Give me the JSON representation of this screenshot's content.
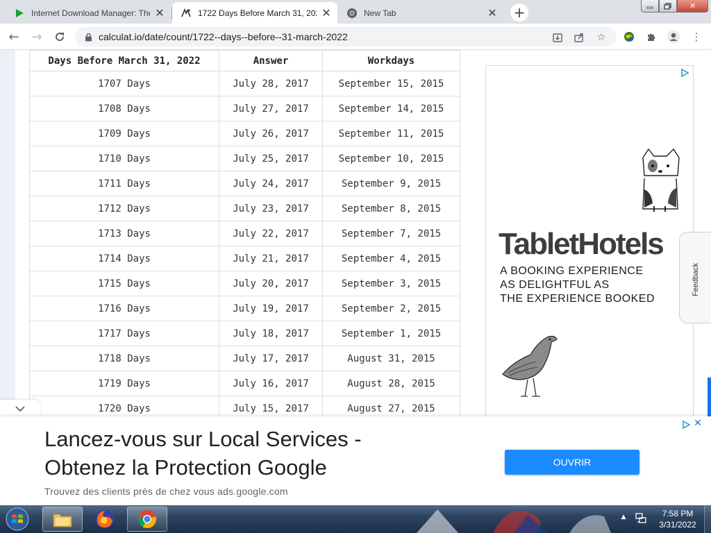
{
  "browser": {
    "tabs": [
      {
        "title": "Internet Download Manager: The",
        "favicon": "idm-play-icon",
        "active": false
      },
      {
        "title": "1722 Days Before March 31, 202",
        "favicon": "calculat-icon",
        "active": true
      },
      {
        "title": "New Tab",
        "favicon": "chrome-icon",
        "active": false
      }
    ],
    "new_tab_symbol": "+",
    "url": "calculat.io/date/count/1722--days--before--31-march-2022"
  },
  "table": {
    "headers": [
      "Days Before March 31, 2022",
      "Answer",
      "Workdays"
    ],
    "rows": [
      [
        "1707 Days",
        "July 28, 2017",
        "September 15, 2015"
      ],
      [
        "1708 Days",
        "July 27, 2017",
        "September 14, 2015"
      ],
      [
        "1709 Days",
        "July 26, 2017",
        "September 11, 2015"
      ],
      [
        "1710 Days",
        "July 25, 2017",
        "September 10, 2015"
      ],
      [
        "1711 Days",
        "July 24, 2017",
        "September 9, 2015"
      ],
      [
        "1712 Days",
        "July 23, 2017",
        "September 8, 2015"
      ],
      [
        "1713 Days",
        "July 22, 2017",
        "September 7, 2015"
      ],
      [
        "1714 Days",
        "July 21, 2017",
        "September 4, 2015"
      ],
      [
        "1715 Days",
        "July 20, 2017",
        "September 3, 2015"
      ],
      [
        "1716 Days",
        "July 19, 2017",
        "September 2, 2015"
      ],
      [
        "1717 Days",
        "July 18, 2017",
        "September 1, 2015"
      ],
      [
        "1718 Days",
        "July 17, 2017",
        "August 31, 2015"
      ],
      [
        "1719 Days",
        "July 16, 2017",
        "August 28, 2015"
      ],
      [
        "1720 Days",
        "July 15, 2017",
        "August 27, 2015"
      ]
    ]
  },
  "side_ad": {
    "brand": "TabletHotels",
    "tagline": [
      "A BOOKING EXPERIENCE",
      "AS DELIGHTFUL AS",
      "THE EXPERIENCE BOOKED"
    ]
  },
  "feedback": {
    "label": "Feedback"
  },
  "anchor_ad": {
    "headline": [
      "Lancez-vous sur Local Services -",
      "Obtenez la Protection Google"
    ],
    "description": "Trouvez des clients près de chez vous ads.google.com",
    "cta": "OUVRIR",
    "close_symbol": "✕"
  },
  "taskbar": {
    "clock_time": "7:58 PM",
    "clock_date": "3/31/2022",
    "apps": [
      "file-explorer-icon",
      "firefox-icon",
      "chrome-icon"
    ]
  },
  "colors": {
    "accent_blue": "#1a73e8",
    "cta_blue": "#1a8cff",
    "tab_strip": "#dee1e6",
    "page_bg": "#eef0f7"
  }
}
